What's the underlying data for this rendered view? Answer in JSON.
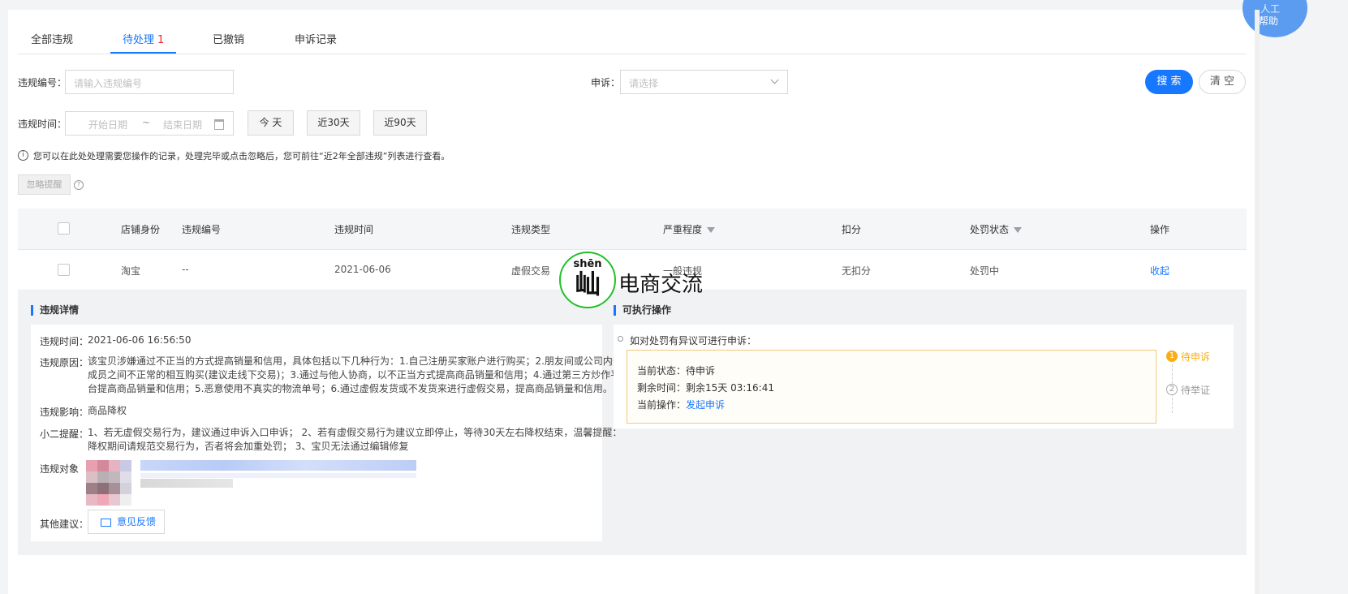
{
  "tabs": [
    {
      "label": "全部违规"
    },
    {
      "label": "待处理",
      "count": "1"
    },
    {
      "label": "已撤销"
    },
    {
      "label": "申诉记录"
    }
  ],
  "filters": {
    "violation_no_label": "违规编号：",
    "violation_no_placeholder": "请输入违规编号",
    "appeal_label": "申诉：",
    "appeal_placeholder": "请选择",
    "search_btn": "搜 索",
    "clear_btn": "清 空",
    "time_label": "违规时间：",
    "start_placeholder": "开始日期",
    "range_sep": "~",
    "end_placeholder": "结束日期",
    "quick": [
      "今 天",
      "近30天",
      "近90天"
    ]
  },
  "notice": "您可以在此处处理需要您操作的记录，处理完毕或点击忽略后，您可前往“近2年全部违规”列表进行查看。",
  "ignore_btn": "忽略提醒",
  "table": {
    "headers": [
      "店铺身份",
      "违规编号",
      "违规时间",
      "违规类型",
      "严重程度",
      "扣分",
      "处罚状态",
      "操作"
    ],
    "row": {
      "shop": "淘宝",
      "no": "--",
      "time": "2021-06-06",
      "type": "虚假交易",
      "severity": "一般违规",
      "points": "无扣分",
      "status": "处罚中",
      "action": "收起"
    }
  },
  "detail": {
    "title": "违规详情",
    "time_key": "违规时间：",
    "time_val": "2021-06-06 16:56:50",
    "reason_key": "违规原因：",
    "reason_lines": [
      "该宝贝涉嫌通过不正当的方式提高销量和信用，具体包括以下几种行为：1.自己注册买家账户进行购买；2.朋友间或公司内部",
      "成员之间不正常的相互购买(建议走线下交易)；3.通过与他人协商，以不正当方式提高商品销量和信用；4.通过第三方炒作平",
      "台提高商品销量和信用；5.恶意使用不真实的物流单号；6.通过虚假发货或不发货来进行虚假交易，提高商品销量和信用。"
    ],
    "impact_key": "违规影响：",
    "impact_val": "商品降权",
    "tip_key": "小二提醒：",
    "tip_lines": [
      "1、若无虚假交易行为，建议通过申诉入口申诉； 2、若有虚假交易行为建议立即停止，等待30天左右降权结束，温馨提醒：",
      "降权期间请规范交易行为，否者将会加重处罚； 3、宝贝无法通过编辑修复"
    ],
    "object_key": "违规对象",
    "other_key": "其他建议：",
    "feedback_btn": "意见反馈"
  },
  "actions": {
    "title": "可执行操作",
    "hint": "如对处罚有异议可进行申诉：",
    "status_key": "当前状态：",
    "status_val": "待申诉",
    "remain_key": "剩余时间：",
    "remain_val": "剩余15天 03:16:41",
    "op_key": "当前操作：",
    "op_val": "发起申诉",
    "steps": [
      {
        "num": "1",
        "label": "待申诉"
      },
      {
        "num": "2",
        "label": "待举证"
      }
    ]
  },
  "watermark": {
    "pinyin": "shēn",
    "glyph": "屾",
    "text": "电商交流"
  },
  "help": {
    "line1": "人工",
    "line2": "帮助"
  }
}
